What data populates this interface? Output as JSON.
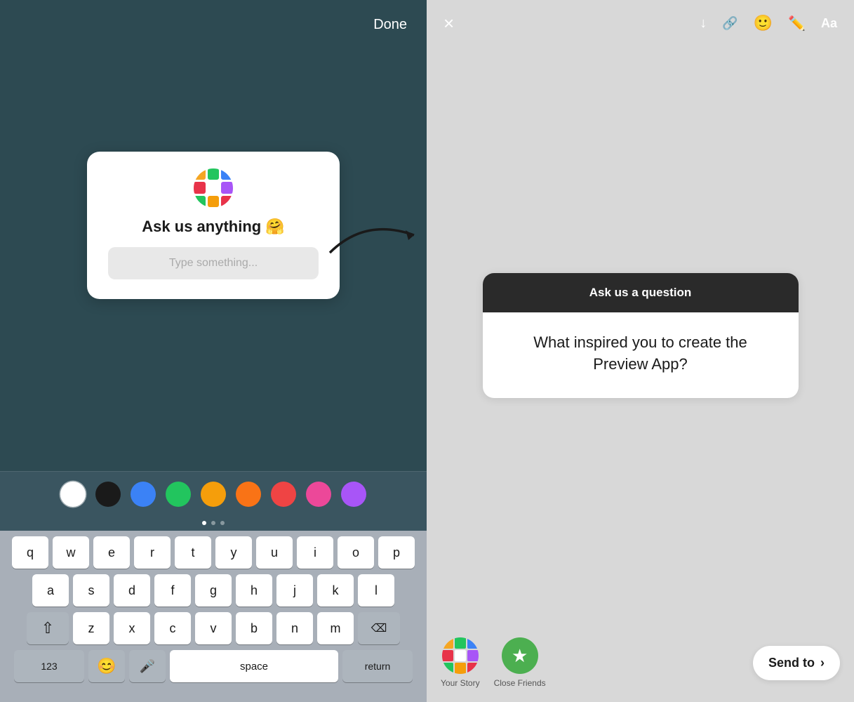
{
  "left": {
    "done_label": "Done",
    "sticker": {
      "title": "Ask us anything 🤗",
      "placeholder": "Type something..."
    },
    "colors": [
      {
        "name": "white",
        "hex": "#ffffff",
        "selected": true
      },
      {
        "name": "black",
        "hex": "#1a1a1a",
        "selected": false
      },
      {
        "name": "blue",
        "hex": "#3b82f6",
        "selected": false
      },
      {
        "name": "green",
        "hex": "#22c55e",
        "selected": false
      },
      {
        "name": "yellow",
        "hex": "#f59e0b",
        "selected": false
      },
      {
        "name": "orange",
        "hex": "#f97316",
        "selected": false
      },
      {
        "name": "red",
        "hex": "#ef4444",
        "selected": false
      },
      {
        "name": "pink",
        "hex": "#ec4899",
        "selected": false
      },
      {
        "name": "purple",
        "hex": "#a855f7",
        "selected": false
      }
    ],
    "keyboard": {
      "rows": [
        [
          "q",
          "w",
          "e",
          "r",
          "t",
          "y",
          "u",
          "i",
          "o",
          "p"
        ],
        [
          "a",
          "s",
          "d",
          "f",
          "g",
          "h",
          "j",
          "k",
          "l"
        ],
        [
          "z",
          "x",
          "c",
          "v",
          "b",
          "n",
          "m"
        ],
        [
          "123",
          "😊",
          "🎤",
          "space",
          "return"
        ]
      ]
    }
  },
  "right": {
    "toolbar": {
      "close_icon": "×",
      "download_icon": "↓",
      "link_icon": "🔗",
      "sticker_icon": "😊",
      "draw_icon": "✏",
      "text_icon": "Aa"
    },
    "question_card": {
      "header": "Ask us a question",
      "answer": "What inspired you to create the Preview App?"
    },
    "bottom": {
      "your_story_label": "Your Story",
      "close_friends_label": "Close Friends",
      "send_to_label": "Send to",
      "chevron": "›"
    }
  }
}
